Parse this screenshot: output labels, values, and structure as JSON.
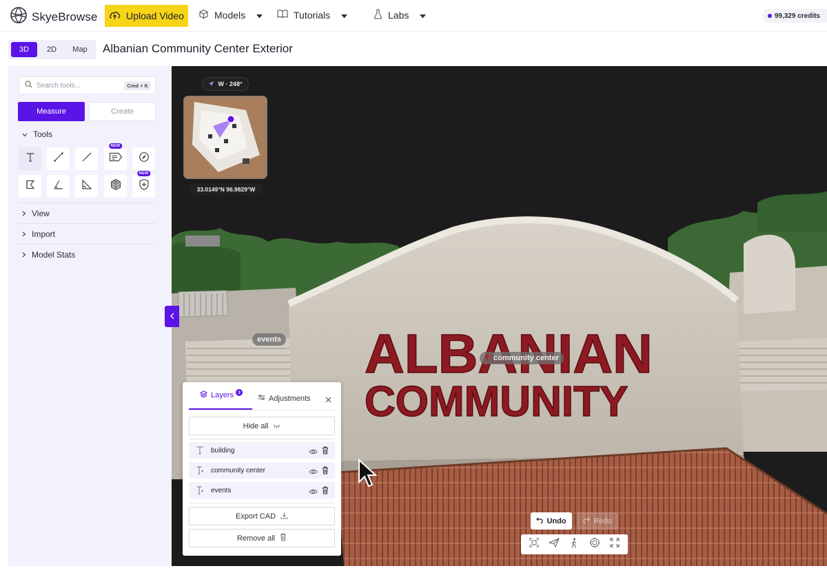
{
  "app": {
    "name": "SkyeBrowse"
  },
  "nav": {
    "upload_label": "Upload Video",
    "items": [
      {
        "label": "Models"
      },
      {
        "label": "Tutorials"
      },
      {
        "label": "Labs"
      }
    ],
    "credits": "99,329 credits"
  },
  "view_toggle": {
    "options": [
      "3D",
      "2D",
      "Map"
    ],
    "active": "3D"
  },
  "page": {
    "title": "Albanian Community Center Exterior"
  },
  "sidebar": {
    "search_placeholder": "Search tools...",
    "search_shortcut": "Cmd + K",
    "mode_tabs": [
      {
        "label": "Measure",
        "active": true
      },
      {
        "label": "Create",
        "active": false
      }
    ],
    "tools_header": "Tools",
    "new_badge": "NEW",
    "sections": [
      "View",
      "Import",
      "Model Stats"
    ]
  },
  "viewport": {
    "compass": "W · 248°",
    "coordinates": "33.0149°N 96.9829°W",
    "scene_labels": {
      "events": "events",
      "community_center": "community center"
    },
    "sign_text": {
      "line1": "ALBANIAN",
      "line2": "COMMUNITY"
    },
    "undo_label": "Undo",
    "redo_label": "Redo"
  },
  "layers_panel": {
    "tabs": {
      "layers": "Layers",
      "adjustments": "Adjustments"
    },
    "layer_count": "3",
    "hide_all_label": "Hide all",
    "layers": [
      {
        "name": "building"
      },
      {
        "name": "community center"
      },
      {
        "name": "events"
      }
    ],
    "export_label": "Export CAD",
    "remove_label": "Remove all"
  },
  "colors": {
    "accent": "#5b14e6",
    "upload": "#f6d417",
    "sidebar_bg": "#f3f1fc"
  }
}
